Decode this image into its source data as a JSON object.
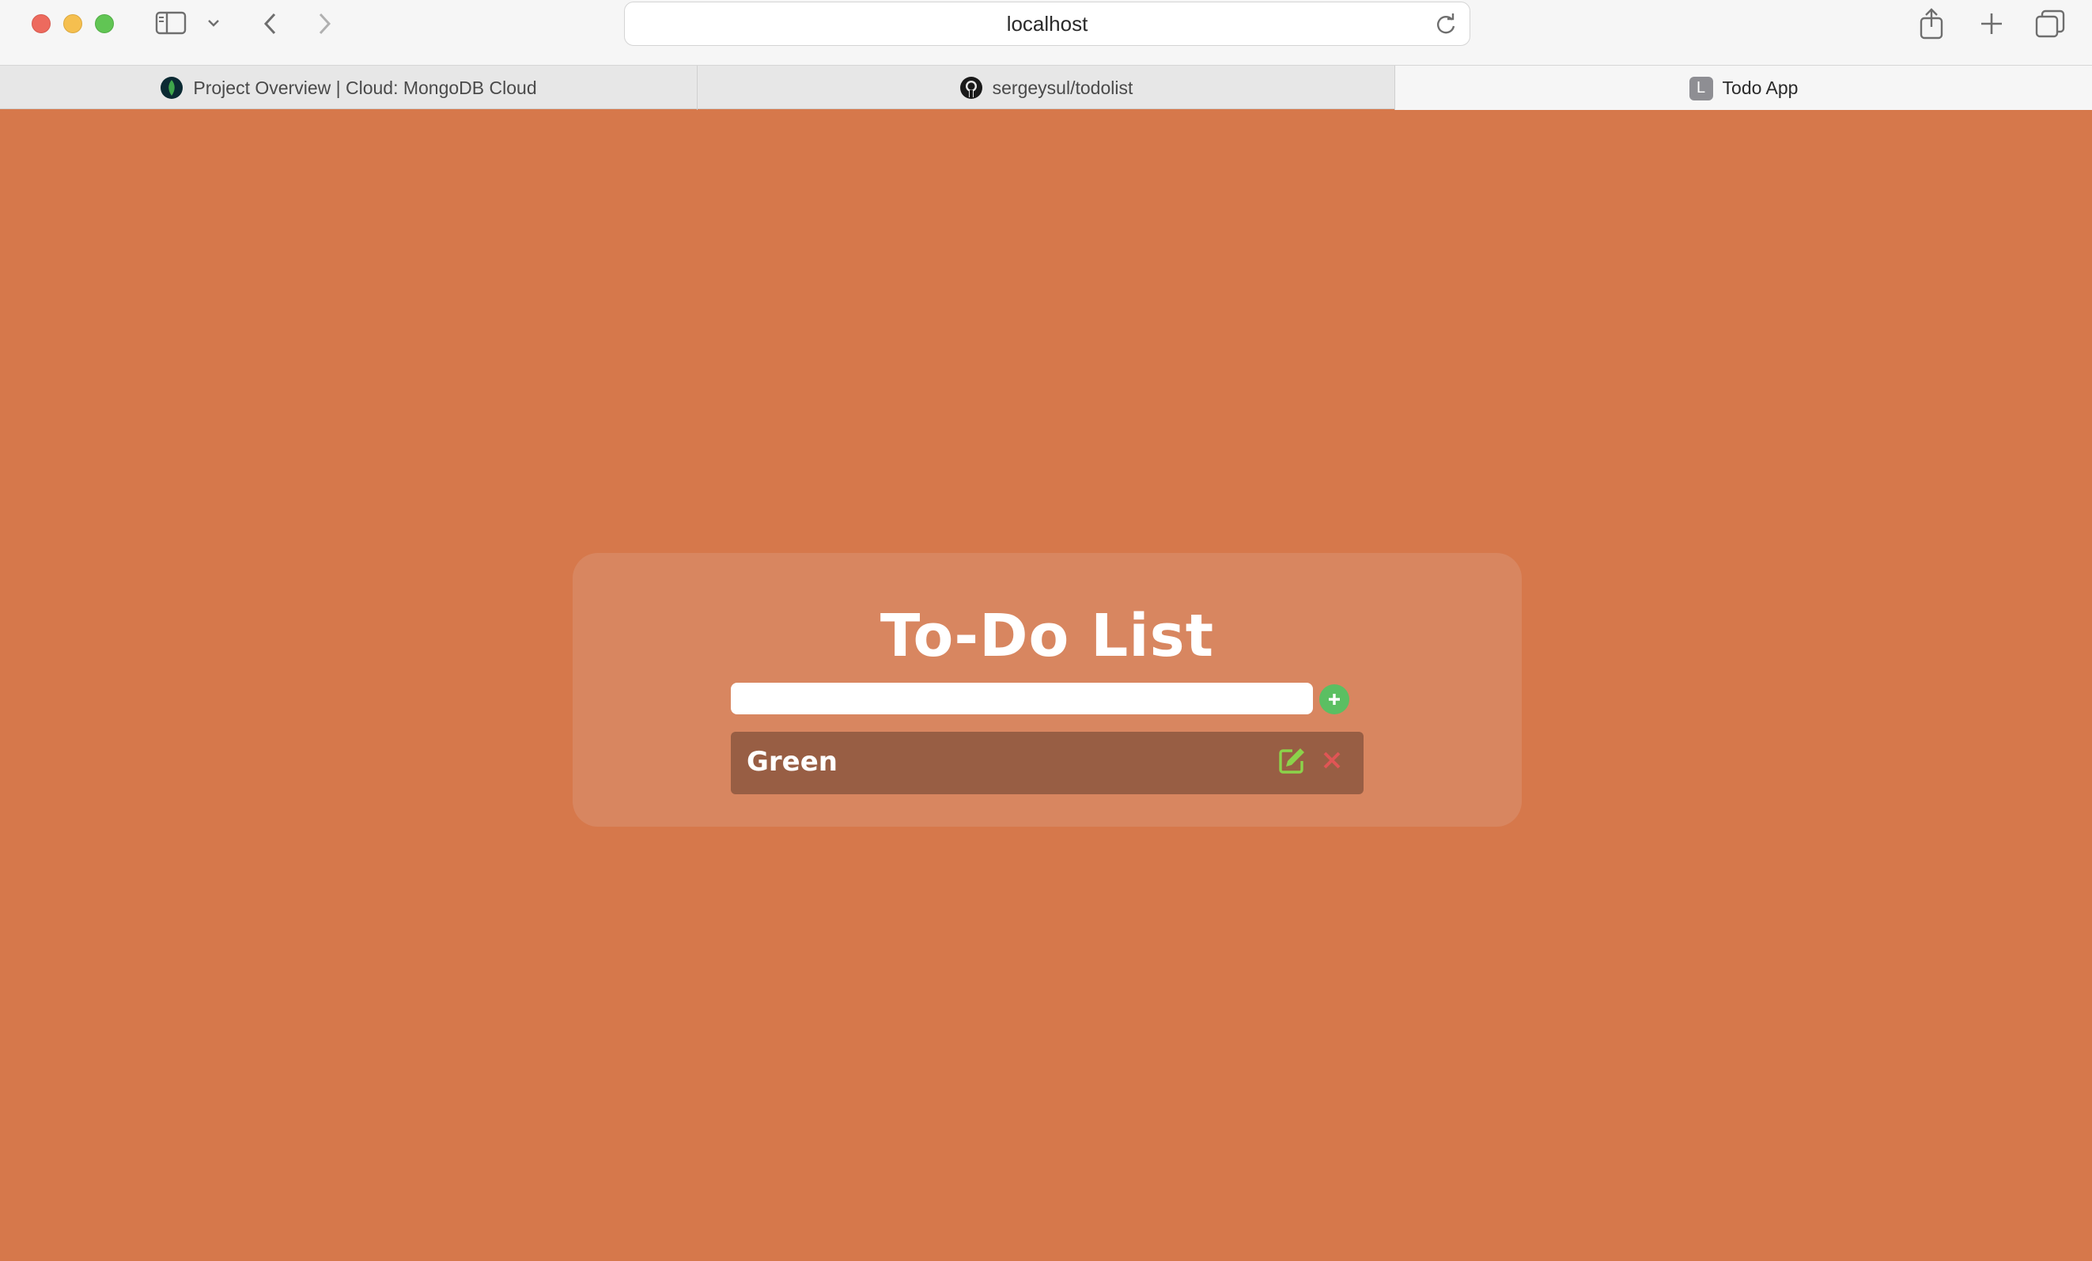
{
  "browser": {
    "url": "localhost",
    "tabs": [
      {
        "label": "Project Overview | Cloud: MongoDB Cloud",
        "icon": "mongodb-leaf-icon"
      },
      {
        "label": "sergeysul/todolist",
        "icon": "github-icon"
      },
      {
        "label": "Todo App",
        "icon_letter": "L",
        "active": true
      }
    ]
  },
  "app": {
    "title": "To-Do List",
    "input": {
      "value": "",
      "placeholder": ""
    },
    "todos": [
      {
        "text": "Green"
      }
    ],
    "colors": {
      "background": "#d6784b",
      "card": "#d88660",
      "item": "#985e44",
      "add": "#5bbf62",
      "edit": "#8bd34a",
      "delete": "#e05555"
    }
  }
}
